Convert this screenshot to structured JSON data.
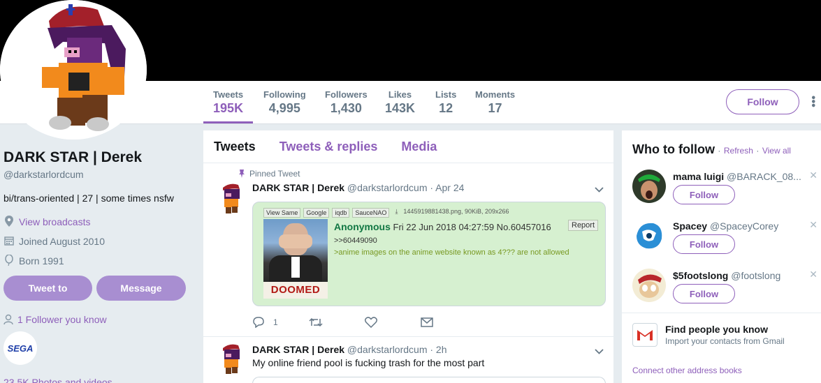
{
  "colors": {
    "accent": "#8e5fba",
    "header_bg": "#000000",
    "page_bg": "#e6ecf0",
    "chan_bg": "#d6f0d0"
  },
  "nav": {
    "stats": [
      {
        "label": "Tweets",
        "value": "195K"
      },
      {
        "label": "Following",
        "value": "4,995"
      },
      {
        "label": "Followers",
        "value": "1,430"
      },
      {
        "label": "Likes",
        "value": "143K"
      },
      {
        "label": "Lists",
        "value": "12"
      },
      {
        "label": "Moments",
        "value": "17"
      }
    ],
    "follow_label": "Follow",
    "more_icon": "more-vertical-icon"
  },
  "profile": {
    "name": "DARK STAR | Derek",
    "handle": "@darkstarlordcum",
    "bio": "bi/trans-oriented | 27 | some times nsfw",
    "broadcasts": "View broadcasts",
    "joined": "Joined August 2010",
    "born": "Born 1991",
    "tweet_to": "Tweet to",
    "message": "Message",
    "followers_you_know": "1 Follower you know",
    "photos": "23.5K Photos and videos"
  },
  "timeline": {
    "tabs": [
      "Tweets",
      "Tweets & replies",
      "Media"
    ],
    "pinned_label": "Pinned Tweet",
    "tweets": [
      {
        "name": "DARK STAR | Derek",
        "handle": "@darkstarlordcum",
        "time": "· Apr 24",
        "text": "",
        "reply_count": "1",
        "card": {
          "buttons": [
            "View Same",
            "Google",
            "iqdb",
            "SauceNAO"
          ],
          "file": "1445919881438.png, 90KiB, 209x266",
          "poster": "Anonymous",
          "post_meta": "Fri 22 Jun 2018 04:27:59 No.60457016",
          "report": "Report",
          "quote_ref": ">>60449090",
          "greentext": ">anime images on the anime website known as 4??? are not allowed",
          "image_caption": "DOOMED"
        }
      },
      {
        "name": "DARK STAR | Derek",
        "handle": "@darkstarlordcum",
        "time": "· 2h",
        "text": "My online friend pool is fucking trash for the most part"
      }
    ]
  },
  "sidebar": {
    "title": "Who to follow",
    "refresh": "Refresh",
    "view_all": "View all",
    "separator": "·",
    "follow_label": "Follow",
    "suggestions": [
      {
        "name": "mama luigi",
        "handle": "@BARACK_08..."
      },
      {
        "name": "Spacey",
        "handle": "@SpaceyCorey"
      },
      {
        "name": "$5footslong",
        "handle": "@footslong"
      }
    ],
    "find_title": "Find people you know",
    "find_sub": "Import your contacts from Gmail",
    "connect": "Connect other address books"
  }
}
